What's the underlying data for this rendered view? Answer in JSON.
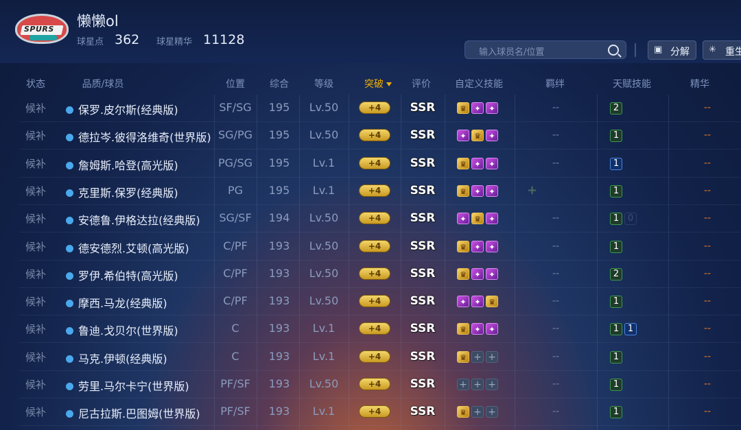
{
  "profile": {
    "team_logo_text": "SPURS",
    "username": "懒懒ol",
    "star_points_label": "球星点",
    "star_points_value": "362",
    "essence_label": "球星精华",
    "essence_value": "11128"
  },
  "toolbar": {
    "search_placeholder": "输入球员名/位置",
    "decompose_label": "分解",
    "rebirth_label": "重生"
  },
  "table": {
    "headers": {
      "status": "状态",
      "player": "品质/球员",
      "position": "位置",
      "overall": "综合",
      "level": "等级",
      "breakthrough": "突破",
      "rating": "评价",
      "custom_skills": "自定义技能",
      "bond": "羁绊",
      "talent": "天赋技能",
      "essence": "精华"
    },
    "rows": [
      {
        "status": "候补",
        "player": "保罗.皮尔斯(经典版)",
        "position": "SF/SG",
        "overall": "195",
        "level": "Lv.50",
        "break": "+4",
        "rating": "SSR",
        "skills": [
          "gold",
          "purple",
          "purple"
        ],
        "bond": "--",
        "talents": [
          {
            "v": "2",
            "t": "green"
          }
        ],
        "essence": "--"
      },
      {
        "status": "候补",
        "player": "德拉岑.彼得洛维奇(世界版)",
        "position": "SG/PG",
        "overall": "195",
        "level": "Lv.50",
        "break": "+4",
        "rating": "SSR",
        "skills": [
          "purple",
          "gold",
          "purple"
        ],
        "bond": "--",
        "talents": [
          {
            "v": "1",
            "t": "green"
          }
        ],
        "essence": "--"
      },
      {
        "status": "候补",
        "player": "詹姆斯.哈登(高光版)",
        "position": "PG/SG",
        "overall": "195",
        "level": "Lv.1",
        "break": "+4",
        "rating": "SSR",
        "skills": [
          "gold",
          "purple",
          "purple"
        ],
        "bond": "--",
        "talents": [
          {
            "v": "1",
            "t": "blue"
          }
        ],
        "essence": "--"
      },
      {
        "status": "候补",
        "player": "克里斯.保罗(经典版)",
        "position": "PG",
        "overall": "195",
        "level": "Lv.1",
        "break": "+4",
        "rating": "SSR",
        "skills": [
          "gold",
          "purple",
          "purple"
        ],
        "bond": "+",
        "talents": [
          {
            "v": "1",
            "t": "green"
          }
        ],
        "essence": "--"
      },
      {
        "status": "候补",
        "player": "安德鲁.伊格达拉(经典版)",
        "position": "SG/SF",
        "overall": "194",
        "level": "Lv.50",
        "break": "+4",
        "rating": "SSR",
        "skills": [
          "purple",
          "gold",
          "purple"
        ],
        "bond": "--",
        "talents": [
          {
            "v": "1",
            "t": "green"
          },
          {
            "v": "0",
            "t": "dim"
          }
        ],
        "essence": "--"
      },
      {
        "status": "候补",
        "player": "德安德烈.艾顿(高光版)",
        "position": "C/PF",
        "overall": "193",
        "level": "Lv.50",
        "break": "+4",
        "rating": "SSR",
        "skills": [
          "gold",
          "purple",
          "purple"
        ],
        "bond": "--",
        "talents": [
          {
            "v": "1",
            "t": "green"
          }
        ],
        "essence": "--"
      },
      {
        "status": "候补",
        "player": "罗伊.希伯特(高光版)",
        "position": "C/PF",
        "overall": "193",
        "level": "Lv.50",
        "break": "+4",
        "rating": "SSR",
        "skills": [
          "gold",
          "purple",
          "purple"
        ],
        "bond": "--",
        "talents": [
          {
            "v": "2",
            "t": "green"
          }
        ],
        "essence": "--"
      },
      {
        "status": "候补",
        "player": "摩西.马龙(经典版)",
        "position": "C/PF",
        "overall": "193",
        "level": "Lv.50",
        "break": "+4",
        "rating": "SSR",
        "skills": [
          "purple",
          "purple",
          "gold"
        ],
        "bond": "--",
        "talents": [
          {
            "v": "1",
            "t": "green"
          }
        ],
        "essence": "--"
      },
      {
        "status": "候补",
        "player": "鲁迪.戈贝尔(世界版)",
        "position": "C",
        "overall": "193",
        "level": "Lv.1",
        "break": "+4",
        "rating": "SSR",
        "skills": [
          "gold",
          "purple",
          "purple"
        ],
        "bond": "--",
        "talents": [
          {
            "v": "1",
            "t": "green"
          },
          {
            "v": "1",
            "t": "blue"
          }
        ],
        "essence": "--"
      },
      {
        "status": "候补",
        "player": "马克.伊顿(经典版)",
        "position": "C",
        "overall": "193",
        "level": "Lv.1",
        "break": "+4",
        "rating": "SSR",
        "skills": [
          "gold",
          "empty",
          "empty"
        ],
        "bond": "--",
        "talents": [
          {
            "v": "1",
            "t": "green"
          }
        ],
        "essence": "--"
      },
      {
        "status": "候补",
        "player": "劳里.马尔卡宁(世界版)",
        "position": "PF/SF",
        "overall": "193",
        "level": "Lv.50",
        "break": "+4",
        "rating": "SSR",
        "skills": [
          "empty",
          "empty",
          "empty"
        ],
        "bond": "--",
        "talents": [
          {
            "v": "1",
            "t": "green"
          }
        ],
        "essence": "--"
      },
      {
        "status": "候补",
        "player": "尼古拉斯.巴图姆(世界版)",
        "position": "PF/SF",
        "overall": "193",
        "level": "Lv.1",
        "break": "+4",
        "rating": "SSR",
        "skills": [
          "gold",
          "empty",
          "empty"
        ],
        "bond": "--",
        "talents": [
          {
            "v": "1",
            "t": "green"
          }
        ],
        "essence": "--"
      }
    ]
  }
}
